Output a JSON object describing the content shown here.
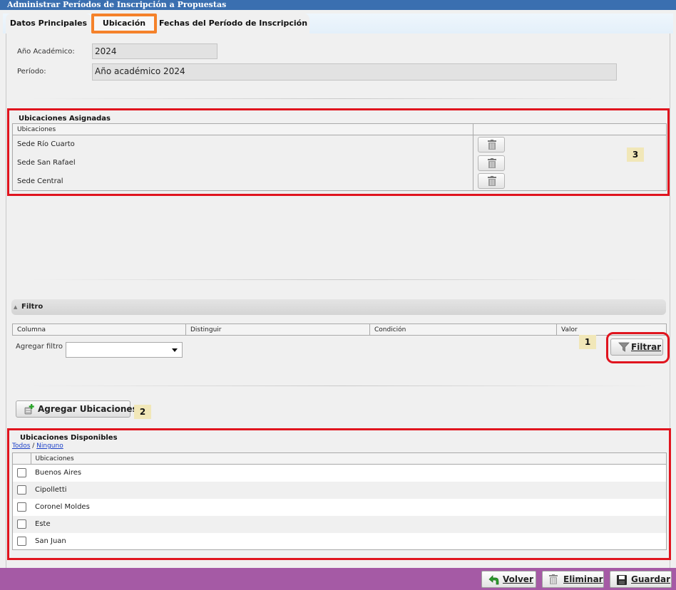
{
  "window": {
    "title": "Administrar Períodos de Inscripción a Propuestas"
  },
  "tabs": [
    {
      "label": "Datos Principales",
      "active": false
    },
    {
      "label": "Ubicación",
      "active": true
    },
    {
      "label": "Fechas del Período de Inscripción",
      "active": false
    }
  ],
  "form": {
    "anio_label": "Año Académico:",
    "anio_value": "2024",
    "periodo_label": "Período:",
    "periodo_value": "Año académico 2024"
  },
  "asignadas": {
    "title": "Ubicaciones Asignadas",
    "column": "Ubicaciones",
    "rows": [
      "Sede Río Cuarto",
      "Sede San Rafael",
      "Sede Central"
    ],
    "delete_icon": "trash-icon"
  },
  "filtro": {
    "title": "Filtro",
    "columns": [
      "Columna",
      "Distinguir",
      "Condición",
      "Valor"
    ],
    "add_label": "Agregar filtro",
    "select_value": "",
    "button_label": "Filtrar",
    "button_icon": "funnel-icon"
  },
  "agregar": {
    "label": "Agregar Ubicaciones",
    "icon": "add-location-icon"
  },
  "disponibles": {
    "title": "Ubicaciones Disponibles",
    "select_all": "Todos",
    "separator": " / ",
    "select_none": "Ninguno",
    "column": "Ubicaciones",
    "rows": [
      "Buenos Aires",
      "Cipolletti",
      "Coronel Moldes",
      "Este",
      "San Juan"
    ]
  },
  "badges": [
    "1",
    "2",
    "3"
  ],
  "footer": {
    "volver": "Volver",
    "eliminar": "Eliminar",
    "guardar": "Guardar"
  },
  "colors": {
    "title_bar": "#3a6fb0",
    "highlight": "#e0141e",
    "active_tab_border": "#f5822a",
    "footer_bg": "#a55aa5",
    "badge_bg": "#f1e7b8"
  }
}
